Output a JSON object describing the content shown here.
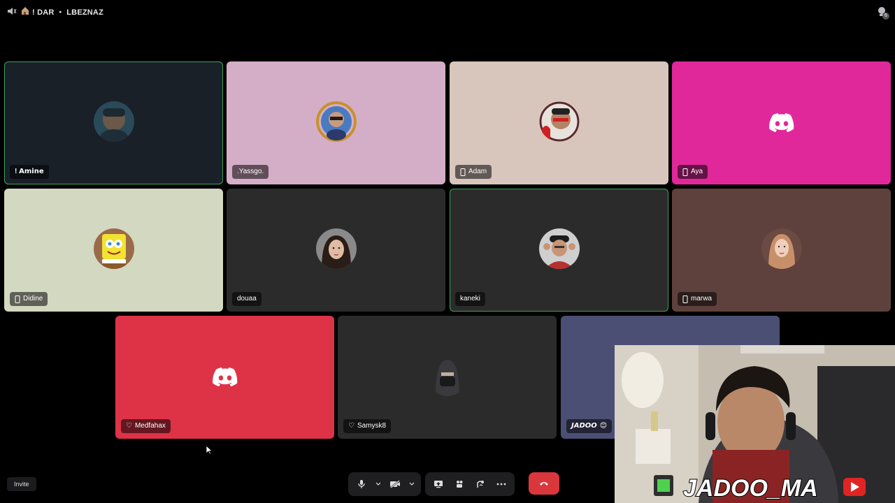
{
  "header": {
    "channel_title": "ǃ DAR ・ LBEZNAZ",
    "icons": [
      "speaker-icon",
      "house-icon",
      "activity-icon"
    ],
    "activity_badge": "6"
  },
  "tiles": [
    {
      "name": "ǃ 𝗔𝗺𝗶𝗻𝗲",
      "bg": "#1a2028",
      "speaking": true,
      "mobile": false,
      "kind": "avatar"
    },
    {
      "name": ".Yassgo.",
      "bg": "#d4aec6",
      "speaking": false,
      "mobile": false,
      "kind": "avatar"
    },
    {
      "name": "Adam",
      "bg": "#d8c6bd",
      "speaking": false,
      "mobile": true,
      "kind": "avatar"
    },
    {
      "name": "Aya",
      "bg": "#e0289b",
      "speaking": false,
      "mobile": true,
      "kind": "discord"
    },
    {
      "name": "Didine",
      "bg": "#d3d8c0",
      "speaking": false,
      "mobile": true,
      "kind": "avatar"
    },
    {
      "name": "douaa",
      "bg": "#2b2b2b",
      "speaking": false,
      "mobile": false,
      "kind": "avatar"
    },
    {
      "name": "kaneki",
      "bg": "#2b2b2b",
      "speaking": true,
      "mobile": false,
      "kind": "avatar"
    },
    {
      "name": "marwa",
      "bg": "#5e413c",
      "speaking": false,
      "mobile": true,
      "kind": "avatar"
    },
    {
      "name": "Medfahax",
      "bg": "#de3347",
      "speaking": false,
      "mobile": false,
      "kind": "discord",
      "prefix": "♡"
    },
    {
      "name": "Samysk8",
      "bg": "#2b2b2b",
      "speaking": false,
      "mobile": false,
      "kind": "avatar",
      "prefix": "♡"
    },
    {
      "name": "𝙅𝘼𝘿𝙊𝙊",
      "bg": "#4c4f74",
      "speaking": false,
      "mobile": false,
      "kind": "avatar",
      "suffix": "😊"
    }
  ],
  "webcam": {
    "overlay_text": "JADOO_MA"
  },
  "toolbar": {
    "buttons": [
      "microphone-icon",
      "mic-options-chevron",
      "camera-off-icon",
      "camera-options-chevron",
      "screen-share-icon",
      "activities-icon",
      "soundboard-icon",
      "more-options-icon",
      "hang-up-icon"
    ],
    "invite_label": "Invite"
  },
  "colors": {
    "speaking_outline": "#3ba55c",
    "hangup": "#da373c",
    "toolbar_bg": "#1f1f22"
  }
}
